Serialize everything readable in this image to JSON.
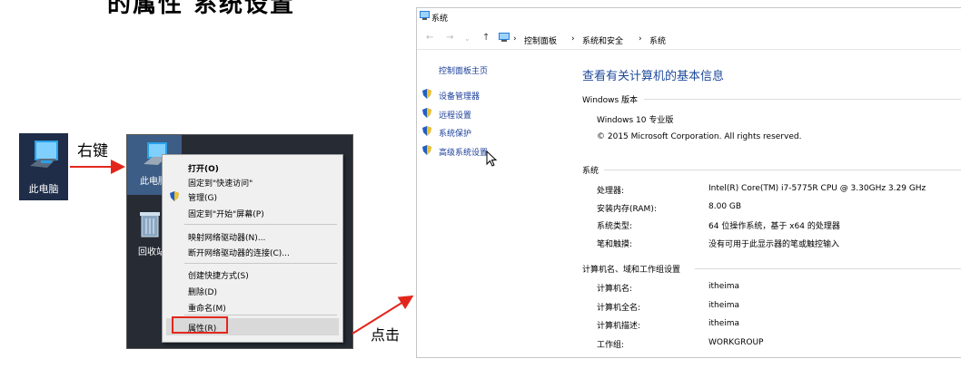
{
  "heading": "的属性       系统设置",
  "left": {
    "pc_label": "此电脑",
    "right_click_label": "右键",
    "click_label": "点击"
  },
  "desktop": {
    "pc_label": "此电脑",
    "recycle_label": "回收站"
  },
  "context_menu": {
    "items": [
      {
        "label": "打开(O)"
      },
      {
        "label": "固定到\"快速访问\""
      },
      {
        "label": "管理(G)"
      },
      {
        "label": "固定到\"开始\"屏幕(P)"
      },
      {
        "label": "映射网络驱动器(N)..."
      },
      {
        "label": "断开网络驱动器的连接(C)..."
      },
      {
        "label": "创建快捷方式(S)"
      },
      {
        "label": "删除(D)"
      },
      {
        "label": "重命名(M)"
      },
      {
        "label": "属性(R)"
      }
    ]
  },
  "window": {
    "title": "系统",
    "breadcrumb": [
      "控制面板",
      "系统和安全",
      "系统"
    ],
    "sidebar": {
      "home": "控制面板主页",
      "items": [
        "设备管理器",
        "远程设置",
        "系统保护",
        "高级系统设置"
      ]
    },
    "main_title": "查看有关计算机的基本信息",
    "edition": {
      "header": "Windows 版本",
      "name": "Windows 10 专业版",
      "copyright": "© 2015 Microsoft Corporation. All rights reserved."
    },
    "system": {
      "header": "系统",
      "rows": [
        {
          "label": "处理器:",
          "value": "Intel(R) Core(TM) i7-5775R CPU @ 3.30GHz   3.29 GHz"
        },
        {
          "label": "安装内存(RAM):",
          "value": "8.00 GB"
        },
        {
          "label": "系统类型:",
          "value": "64 位操作系统，基于 x64 的处理器"
        },
        {
          "label": "笔和触摸:",
          "value": "没有可用于此显示器的笔或触控输入"
        }
      ]
    },
    "computer": {
      "header": "计算机名、域和工作组设置",
      "rows": [
        {
          "label": "计算机名:",
          "value": "itheima"
        },
        {
          "label": "计算机全名:",
          "value": "itheima"
        },
        {
          "label": "计算机描述:",
          "value": "itheima"
        },
        {
          "label": "工作组:",
          "value": "WORKGROUP"
        }
      ]
    }
  },
  "colors": {
    "link": "#1a3e9a",
    "title": "#1e4a9b",
    "arrow": "#e3261c",
    "highlight": "#e3261c"
  }
}
